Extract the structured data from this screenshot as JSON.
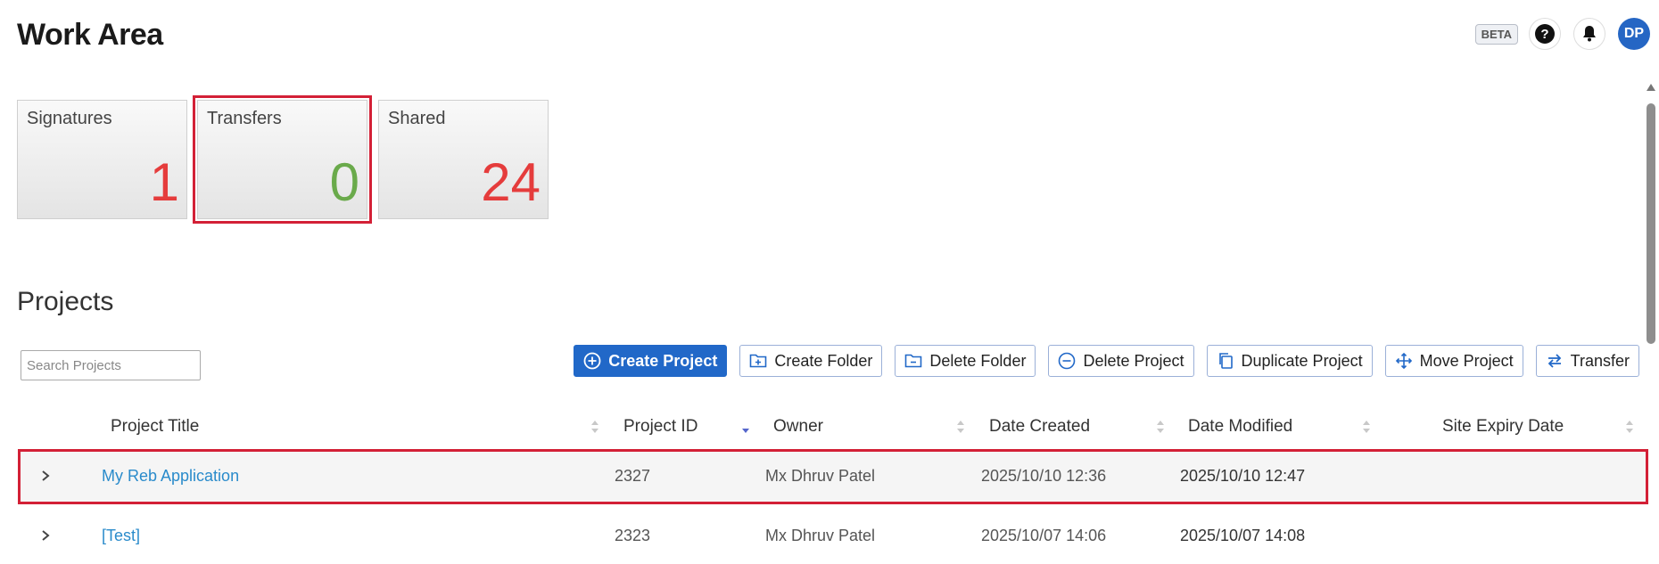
{
  "header": {
    "title": "Work Area",
    "beta": "BETA",
    "help_glyph": "?",
    "avatar_initials": "DP"
  },
  "cards": [
    {
      "label": "Signatures",
      "value": "1",
      "color": "#e53c3c"
    },
    {
      "label": "Transfers",
      "value": "0",
      "color": "#6aaa4b"
    },
    {
      "label": "Shared",
      "value": "24",
      "color": "#e53c3c"
    }
  ],
  "projects": {
    "title": "Projects",
    "search_placeholder": "Search Projects",
    "toolbar": {
      "create_project": "Create Project",
      "create_folder": "Create Folder",
      "delete_folder": "Delete Folder",
      "delete_project": "Delete Project",
      "duplicate_project": "Duplicate Project",
      "move_project": "Move Project",
      "transfer": "Transfer"
    },
    "columns": {
      "title": "Project Title",
      "id": "Project ID",
      "owner": "Owner",
      "created": "Date Created",
      "modified": "Date Modified",
      "expiry": "Site Expiry Date"
    },
    "rows": [
      {
        "title": "My Reb Application",
        "id": "2327",
        "owner": "Mx Dhruv Patel",
        "created": "2025/10/10 12:36",
        "modified": "2025/10/10 12:47",
        "expiry": ""
      },
      {
        "title": "[Test]",
        "id": "2323",
        "owner": "Mx Dhruv Patel",
        "created": "2025/10/07 14:06",
        "modified": "2025/10/07 14:08",
        "expiry": ""
      }
    ]
  },
  "colors": {
    "primary": "#2168c8",
    "link": "#2a8bcb",
    "highlight": "#d32036",
    "count_red": "#e53c3c",
    "count_green": "#6aaa4b"
  }
}
